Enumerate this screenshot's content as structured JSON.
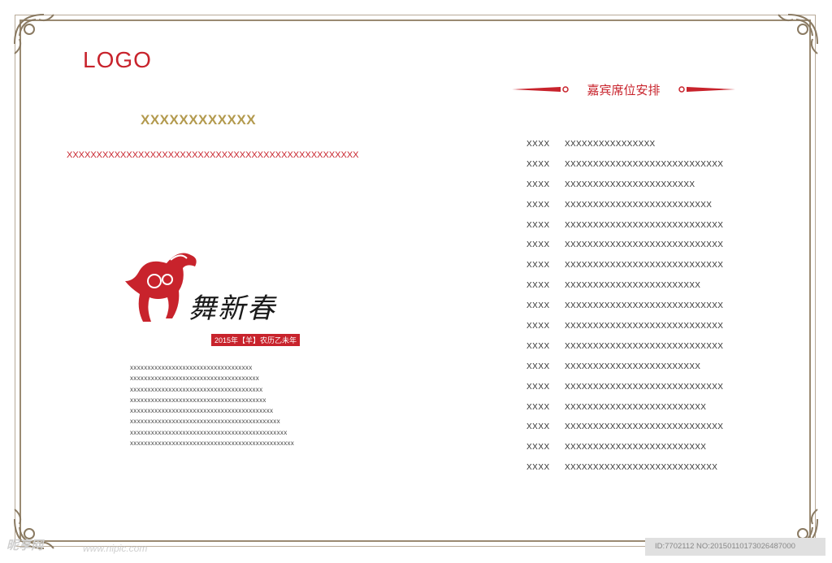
{
  "header": {
    "logo": "LOGO",
    "title": "XXXXXXXXXXXX",
    "subtitle": "XXXXXXXXXXXXXXXXXXXXXXXXXXXXXXXXXXXXXXXXXXXXXXXXX"
  },
  "art": {
    "calligraphy": "舞新春",
    "year_badge": "2015年【羊】农历乙未年"
  },
  "body_lines": [
    "xxxxxxxxxxxxxxxxxxxxxxxxxxxxxxxxxxx",
    "xxxxxxxxxxxxxxxxxxxxxxxxxxxxxxxxxxxxx",
    "xxxxxxxxxxxxxxxxxxxxxxxxxxxxxxxxxxxxxx",
    "xxxxxxxxxxxxxxxxxxxxxxxxxxxxxxxxxxxxxxx",
    "xxxxxxxxxxxxxxxxxxxxxxxxxxxxxxxxxxxxxxxxx",
    "xxxxxxxxxxxxxxxxxxxxxxxxxxxxxxxxxxxxxxxxxxx",
    "xxxxxxxxxxxxxxxxxxxxxxxxxxxxxxxxxxxxxxxxxxxxx",
    "xxxxxxxxxxxxxxxxxxxxxxxxxxxxxxxxxxxxxxxxxxxxxxx"
  ],
  "seating": {
    "title": "嘉宾席位安排",
    "rows": [
      {
        "label": "XXXX",
        "name": "XXXXXXXXXXXXXXXX"
      },
      {
        "label": "XXXX",
        "name": "XXXXXXXXXXXXXXXXXXXXXXXXXXXX"
      },
      {
        "label": "XXXX",
        "name": "XXXXXXXXXXXXXXXXXXXXXXX"
      },
      {
        "label": "XXXX",
        "name": "XXXXXXXXXXXXXXXXXXXXXXXXXX"
      },
      {
        "label": "XXXX",
        "name": "XXXXXXXXXXXXXXXXXXXXXXXXXXXX"
      },
      {
        "label": "XXXX",
        "name": "XXXXXXXXXXXXXXXXXXXXXXXXXXXX"
      },
      {
        "label": "XXXX",
        "name": "XXXXXXXXXXXXXXXXXXXXXXXXXXXX"
      },
      {
        "label": "XXXX",
        "name": "XXXXXXXXXXXXXXXXXXXXXXXX"
      },
      {
        "label": "XXXX",
        "name": "XXXXXXXXXXXXXXXXXXXXXXXXXXXX"
      },
      {
        "label": "XXXX",
        "name": "XXXXXXXXXXXXXXXXXXXXXXXXXXXX"
      },
      {
        "label": "XXXX",
        "name": "XXXXXXXXXXXXXXXXXXXXXXXXXXXX"
      },
      {
        "label": "XXXX",
        "name": "XXXXXXXXXXXXXXXXXXXXXXXX"
      },
      {
        "label": "XXXX",
        "name": "XXXXXXXXXXXXXXXXXXXXXXXXXXXX"
      },
      {
        "label": "XXXX",
        "name": "XXXXXXXXXXXXXXXXXXXXXXXXX"
      },
      {
        "label": "XXXX",
        "name": "XXXXXXXXXXXXXXXXXXXXXXXXXXXX"
      },
      {
        "label": "XXXX",
        "name": "XXXXXXXXXXXXXXXXXXXXXXXXX"
      },
      {
        "label": "XXXX",
        "name": "XXXXXXXXXXXXXXXXXXXXXXXXXXX"
      }
    ]
  },
  "watermark": {
    "site": "昵享网",
    "url": "www.nipic.com",
    "id_text": "ID:7702112 NO:20150110173026487000"
  },
  "colors": {
    "accent_red": "#c8232c",
    "gold": "#b39a4e",
    "frame": "#9a8a72"
  }
}
